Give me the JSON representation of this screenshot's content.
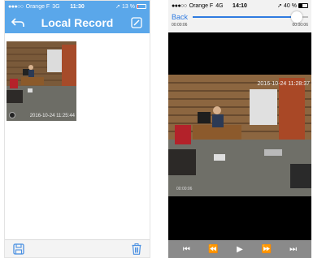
{
  "left": {
    "status": {
      "carrier": "Orange F",
      "network": "3G",
      "time": "11:30",
      "battery": "13 %",
      "battery_level": 0.13
    },
    "nav": {
      "title": "Local Record",
      "back_icon": "back-arrow-icon",
      "edit_icon": "edit-icon"
    },
    "recordings": [
      {
        "timestamp": "2016-10-24 11:25:44"
      }
    ],
    "bottom": {
      "save_icon": "save-icon",
      "trash_icon": "trash-icon"
    }
  },
  "right": {
    "status": {
      "carrier": "Orange F",
      "network": "4G",
      "time": "14:10",
      "battery": "40 %",
      "battery_level": 0.4
    },
    "back_label": "Back",
    "playback": {
      "current": "00:00:06",
      "total": "00:00:06",
      "progress": 0.9
    },
    "video": {
      "timestamp": "2016-10-24 11:28:37",
      "tag": "00:00:06"
    },
    "controls": [
      "skip-back-icon",
      "rewind-icon",
      "play-icon",
      "fast-forward-icon",
      "skip-forward-icon"
    ]
  },
  "colors": {
    "accent": "#5aa7ea",
    "link": "#2f7be0",
    "control_bar": "#8a8a8a"
  }
}
